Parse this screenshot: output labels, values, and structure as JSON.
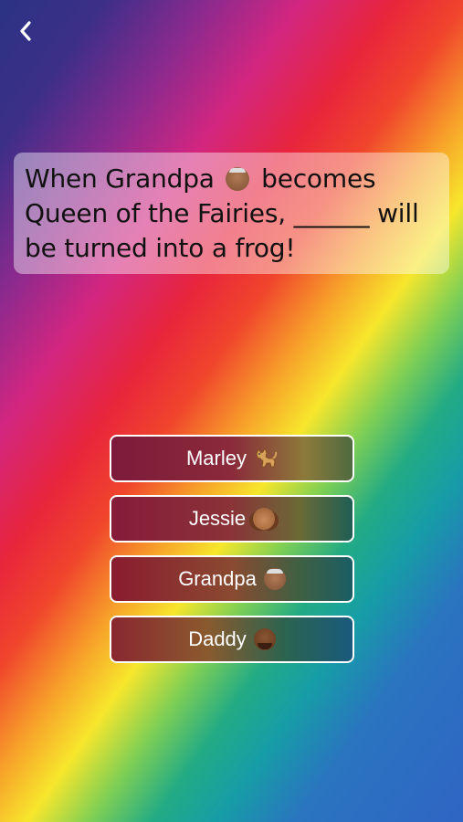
{
  "nav": {
    "back_icon": "chevron-left-icon"
  },
  "question": {
    "text_part1": "When Grandpa",
    "emoji": "older-man-emoji",
    "text_part2": "becomes Queen of the Fairies, ______ will be turned into a frog!"
  },
  "answers": [
    {
      "label": "Marley",
      "icon": "cat-emoji"
    },
    {
      "label": "Jessie",
      "icon": "girl-emoji"
    },
    {
      "label": "Grandpa",
      "icon": "older-man-emoji"
    },
    {
      "label": "Daddy",
      "icon": "man-emoji"
    }
  ],
  "colors": {
    "card_bg": "rgba(255,255,255,0.42)",
    "answer_border": "#ffffff",
    "answer_text": "#ffffff"
  }
}
